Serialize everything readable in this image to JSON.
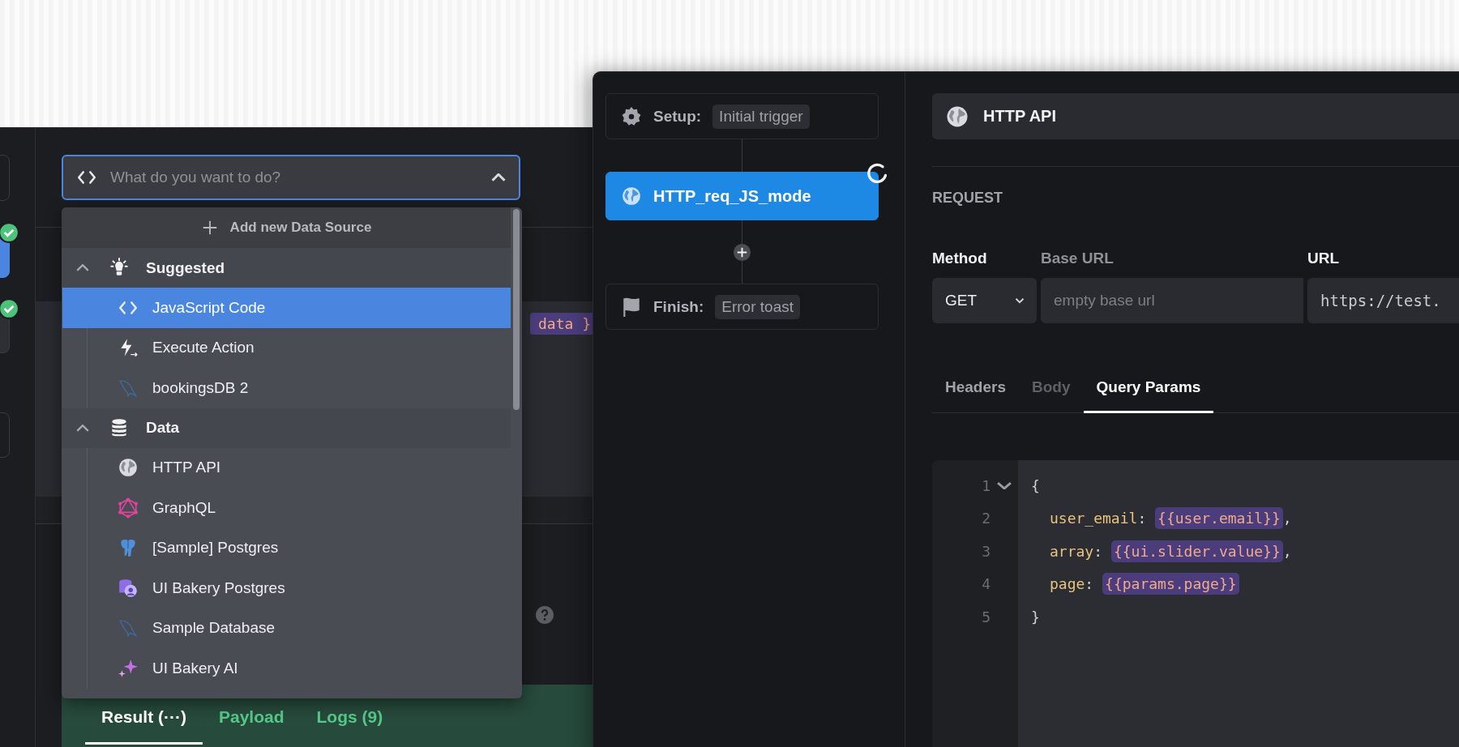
{
  "back_window": {
    "action_field": {
      "placeholder": "What do you want to do?",
      "expanded": true
    },
    "behind_code": "data }",
    "menu": {
      "add_label": "Add new Data Source",
      "sections": [
        {
          "title": "Suggested",
          "kind": "bulb",
          "expanded": true,
          "children": [
            {
              "label": "JavaScript Code",
              "kind": "code",
              "selected": true
            },
            {
              "label": "Execute Action",
              "kind": "bolt",
              "selected": false
            },
            {
              "label": "bookingsDB 2",
              "kind": "dolphin",
              "selected": false
            }
          ]
        },
        {
          "title": "Data",
          "kind": "database",
          "expanded": true,
          "children": [
            {
              "label": "HTTP API",
              "kind": "globe",
              "selected": false
            },
            {
              "label": "GraphQL",
              "kind": "graphql",
              "selected": false
            },
            {
              "label": "[Sample] Postgres",
              "kind": "elephant",
              "selected": false
            },
            {
              "label": "UI Bakery Postgres",
              "kind": "dbuser",
              "selected": false
            },
            {
              "label": "Sample Database",
              "kind": "dolphin",
              "selected": false
            },
            {
              "label": "UI Bakery AI",
              "kind": "sparkle",
              "selected": false
            }
          ]
        }
      ]
    },
    "result_tabs": [
      {
        "label": "Result (···)",
        "selected": true
      },
      {
        "label": "Payload",
        "selected": false
      },
      {
        "label": "Logs (9)",
        "selected": false
      }
    ]
  },
  "flow": {
    "nodes": [
      {
        "kind": "setup",
        "prefix": "Setup:",
        "tag": "Initial trigger"
      },
      {
        "kind": "step",
        "label": "HTTP_req_JS_mode",
        "selected": true,
        "loading": true
      },
      {
        "kind": "finish",
        "prefix": "Finish:",
        "tag": "Error toast"
      }
    ]
  },
  "request": {
    "source": "HTTP API",
    "section": "REQUEST",
    "method_label": "Method",
    "method": "GET",
    "base_url_label": "Base URL",
    "base_url_placeholder": "empty base url",
    "url_label": "URL",
    "url": "https://test.",
    "tabs": [
      {
        "label": "Headers",
        "selected": false,
        "disabled": false
      },
      {
        "label": "Body",
        "selected": false,
        "disabled": true
      },
      {
        "label": "Query Params",
        "selected": true,
        "disabled": false
      }
    ],
    "code": [
      {
        "number": "1",
        "foldable": true,
        "tokens": [
          {
            "kind": "punct",
            "text": "{"
          }
        ]
      },
      {
        "number": "2",
        "foldable": false,
        "tokens": [
          {
            "kind": "key",
            "text": "user_email"
          },
          {
            "kind": "punct",
            "text": ": "
          },
          {
            "kind": "expr",
            "text": "{{user.email}}"
          },
          {
            "kind": "punct",
            "text": ","
          }
        ]
      },
      {
        "number": "3",
        "foldable": false,
        "tokens": [
          {
            "kind": "key",
            "text": "array"
          },
          {
            "kind": "punct",
            "text": ": "
          },
          {
            "kind": "expr",
            "text": "{{ui.slider.value}}"
          },
          {
            "kind": "punct",
            "text": ","
          }
        ]
      },
      {
        "number": "4",
        "foldable": false,
        "tokens": [
          {
            "kind": "key",
            "text": "page"
          },
          {
            "kind": "punct",
            "text": ": "
          },
          {
            "kind": "expr",
            "text": "{{params.page}}"
          }
        ]
      },
      {
        "number": "5",
        "foldable": false,
        "tokens": [
          {
            "kind": "punct",
            "text": "}"
          }
        ]
      }
    ]
  }
}
